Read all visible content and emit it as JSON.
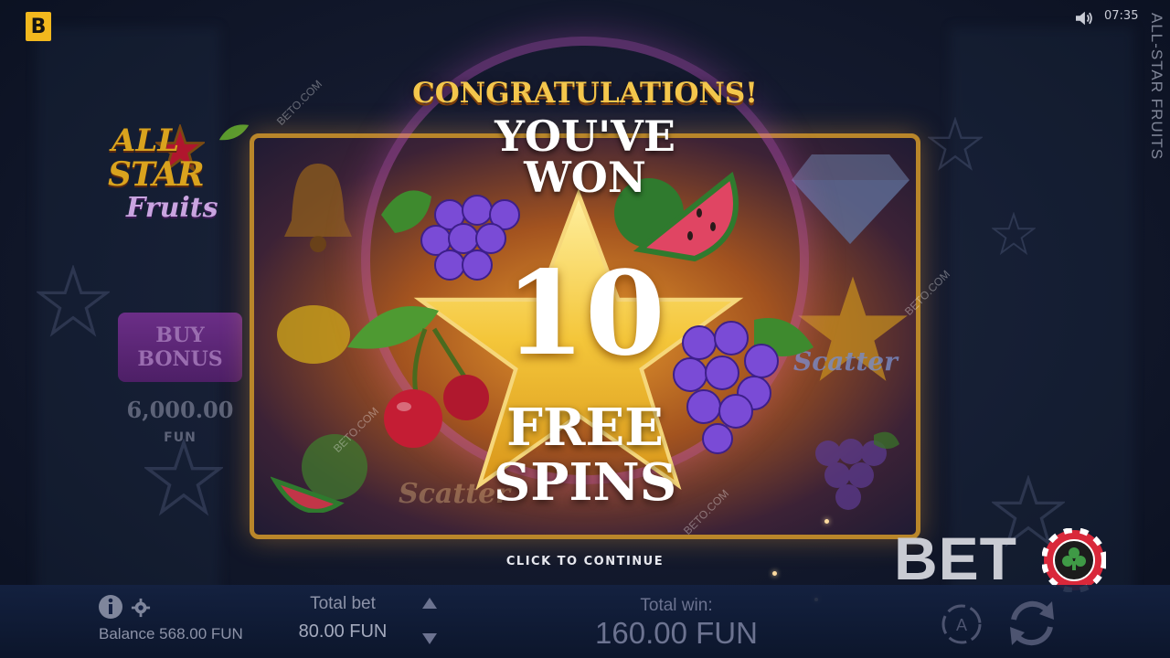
{
  "top_bar": {
    "provider_logo": "B",
    "time": "07:35",
    "game_title_vertical": "ALL-STAR FRUITS"
  },
  "game_logo": {
    "line1": "ALL",
    "line2": "STAR",
    "line3": "Fruits"
  },
  "buy_bonus": {
    "line1": "BUY",
    "line2": "BONUS",
    "price": "6,000.00",
    "unit": "FUN"
  },
  "popup": {
    "congrats": "CONGRATULATIONS!",
    "youve": "YOU'VE",
    "won": "WON",
    "spin_count": "10",
    "free": "FREE",
    "spins": "SPINS",
    "continue": "CLICK TO CONTINUE"
  },
  "reels": {
    "symbols": [
      "bell-icon",
      "lemon-icon",
      "watermelon-icon",
      "grapes-icon",
      "cherry-icon",
      "diamond-icon",
      "scatter-star-icon",
      "grapes-icon"
    ],
    "scatter_text": "Scatter"
  },
  "watermark": "BETO.COM",
  "brand": {
    "text": "BET",
    "chip": "chip-club-icon"
  },
  "bottom_bar": {
    "balance": "Balance 568.00 FUN",
    "total_bet_label": "Total bet",
    "total_bet_value": "80.00 FUN",
    "total_win_label": "Total win:",
    "total_win_value": "160.00 FUN"
  },
  "colors": {
    "gold": "#f3c64c",
    "frame": "#b9862a",
    "buy_bonus_bg": "#6b2e87",
    "bar_text": "#8d93a8"
  }
}
